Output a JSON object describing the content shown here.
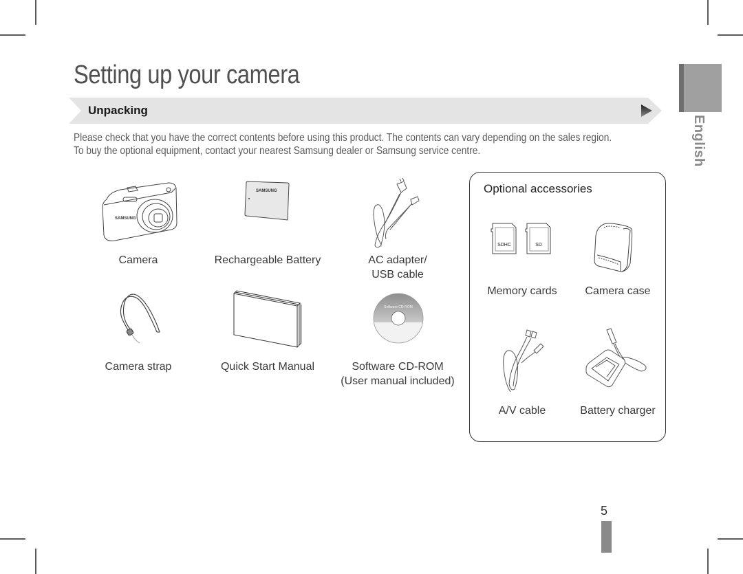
{
  "page": {
    "title": "Setting up your camera",
    "section": {
      "label": "Unpacking",
      "icon": "play-triangle-icon"
    },
    "intro": [
      "Please check that you have the correct contents before using this product. The contents can vary depending on the sales region.",
      "To buy the optional equipment, contact your nearest Samsung dealer or Samsung service centre."
    ],
    "language_tab": "English",
    "page_number": "5"
  },
  "contents": [
    {
      "name": "Camera",
      "icon": "camera-icon",
      "lines": [
        "Camera"
      ]
    },
    {
      "name": "Rechargeable Battery",
      "icon": "battery-icon",
      "lines": [
        "Rechargeable Battery"
      ],
      "brand": "SAMSUNG"
    },
    {
      "name": "AC adapter/USB cable",
      "icon": "ac-adapter-icon",
      "lines": [
        "AC adapter/",
        "USB cable"
      ]
    },
    {
      "name": "Camera strap",
      "icon": "strap-icon",
      "lines": [
        "Camera strap"
      ]
    },
    {
      "name": "Quick Start Manual",
      "icon": "manual-icon",
      "lines": [
        "Quick Start Manual"
      ]
    },
    {
      "name": "Software CD-ROM",
      "icon": "cd-rom-icon",
      "lines": [
        "Software CD-ROM",
        "(User manual included)"
      ],
      "disc_label": "Software CD-ROM"
    }
  ],
  "optional": {
    "title": "Optional accessories",
    "items": [
      {
        "name": "Memory cards",
        "icon": "memory-card-icon",
        "label": "Memory cards",
        "card_labels": [
          "SDHC",
          "SD"
        ]
      },
      {
        "name": "Camera case",
        "icon": "camera-case-icon",
        "label": "Camera case"
      },
      {
        "name": "A/V cable",
        "icon": "av-cable-icon",
        "label": "A/V cable"
      },
      {
        "name": "Battery charger",
        "icon": "battery-charger-icon",
        "label": "Battery charger"
      }
    ]
  }
}
